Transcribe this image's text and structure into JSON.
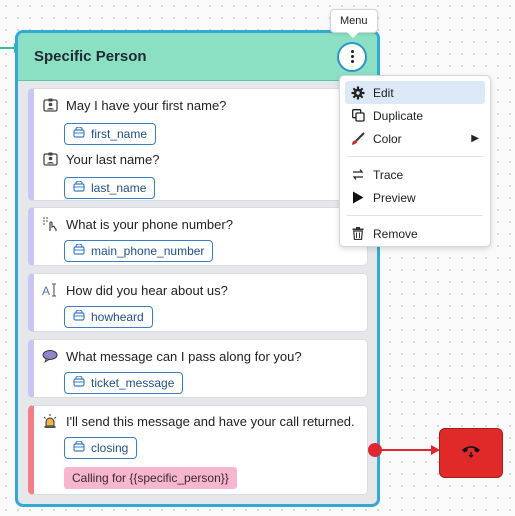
{
  "node": {
    "title": "Specific Person",
    "steps": [
      {
        "icon": "contact-card-icon",
        "question": "May I have your first name?",
        "variable": "first_name"
      },
      {
        "icon": "contact-card-icon",
        "question": "Your last name?",
        "variable": "last_name"
      },
      {
        "icon": "keypad-touch-icon",
        "question": "What is your phone number?",
        "variable": "main_phone_number"
      },
      {
        "icon": "text-input-icon",
        "question": "How did you hear about us?",
        "variable": "howheard"
      },
      {
        "icon": "speech-bubble-icon",
        "question": "What message can I pass along for you?",
        "variable": "ticket_message"
      },
      {
        "icon": "alarm-bell-icon",
        "question": "I'll send this message and have your call returned.",
        "variable": "closing",
        "tag": "Calling for {{specific_person}}"
      }
    ]
  },
  "tooltip": "Menu",
  "menu": {
    "items": [
      {
        "label": "Edit",
        "icon": "gear-icon",
        "active": true
      },
      {
        "label": "Duplicate",
        "icon": "copy-icon"
      },
      {
        "label": "Color",
        "icon": "paint-brush-icon",
        "submenu": true
      },
      {
        "label": "Trace",
        "icon": "trace-arrows-icon"
      },
      {
        "label": "Preview",
        "icon": "play-icon"
      },
      {
        "label": "Remove",
        "icon": "trash-icon"
      }
    ]
  },
  "colors": {
    "header": "#8be0c4",
    "node_border": "#34a9d6",
    "step_accent": "#c9c6f3",
    "end_accent": "#f47d87",
    "hangup": "#e02a2a",
    "variable_border": "#3a7fc6",
    "tag_bg": "#f6b6cf"
  }
}
